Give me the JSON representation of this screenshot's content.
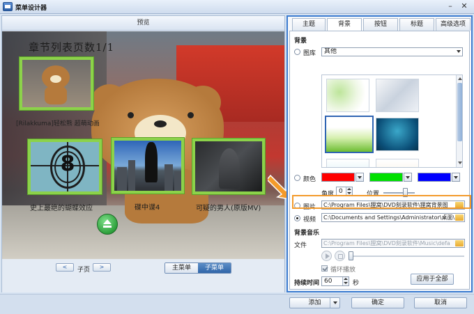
{
  "window": {
    "title": "菜单设计器"
  },
  "preview": {
    "header": "预览",
    "stage_title": "章节列表页数1/1",
    "thumbnails": [
      {
        "label": "[Rilakkuma]轻松熊 超萌动画"
      },
      {
        "label": "史上最绝的蝴蝶效应",
        "countdown": "8"
      },
      {
        "label": "碟中谍4"
      },
      {
        "label": "可疑的男人(原版MV)"
      }
    ],
    "pager": {
      "prev": "<",
      "label": "子页",
      "next": ">"
    },
    "menu_toggle": {
      "main": "主菜单",
      "sub": "子菜单",
      "active": "sub"
    }
  },
  "settings": {
    "tabs": [
      {
        "label": "主题",
        "active": false
      },
      {
        "label": "背景",
        "active": true
      },
      {
        "label": "按钮",
        "active": false
      },
      {
        "label": "标题",
        "active": false
      },
      {
        "label": "高级选项",
        "active": false
      }
    ],
    "background": {
      "section_title": "背景",
      "gallery_option": {
        "label": "图库",
        "selected": false,
        "category": "其他"
      },
      "color_option": {
        "label": "颜色",
        "selected": false,
        "colors": [
          "#ff0000",
          "#00e000",
          "#0000ff"
        ]
      },
      "angle": {
        "label": "角度",
        "value": "0"
      },
      "position": {
        "label": "位置",
        "value": 0.7
      },
      "image_option": {
        "label": "图片",
        "selected": false,
        "path": "C:\\Program Files\\狸窝\\DVD刻录软件\\狸窝背景图"
      },
      "video_option": {
        "label": "视频",
        "selected": true,
        "path": "C:\\Documents and Settings\\Administrator\\桌面\\"
      }
    },
    "music": {
      "section_title": "背景音乐",
      "file_label": "文件",
      "file_path": "C:\\Program Files\\狸窝\\DVD刻录软件\\Music\\defa",
      "loop_label": "循环播放",
      "loop_checked": true
    },
    "duration": {
      "label": "持续时间",
      "value": "60",
      "unit": "秒"
    },
    "apply_all": "应用于全部"
  },
  "bottom": {
    "add": "添加",
    "ok": "确定",
    "cancel": "取消"
  },
  "colors": {
    "accent": "#3b7bd0",
    "highlight": "#f39a2a",
    "thumb_border": "#8cd24a"
  }
}
